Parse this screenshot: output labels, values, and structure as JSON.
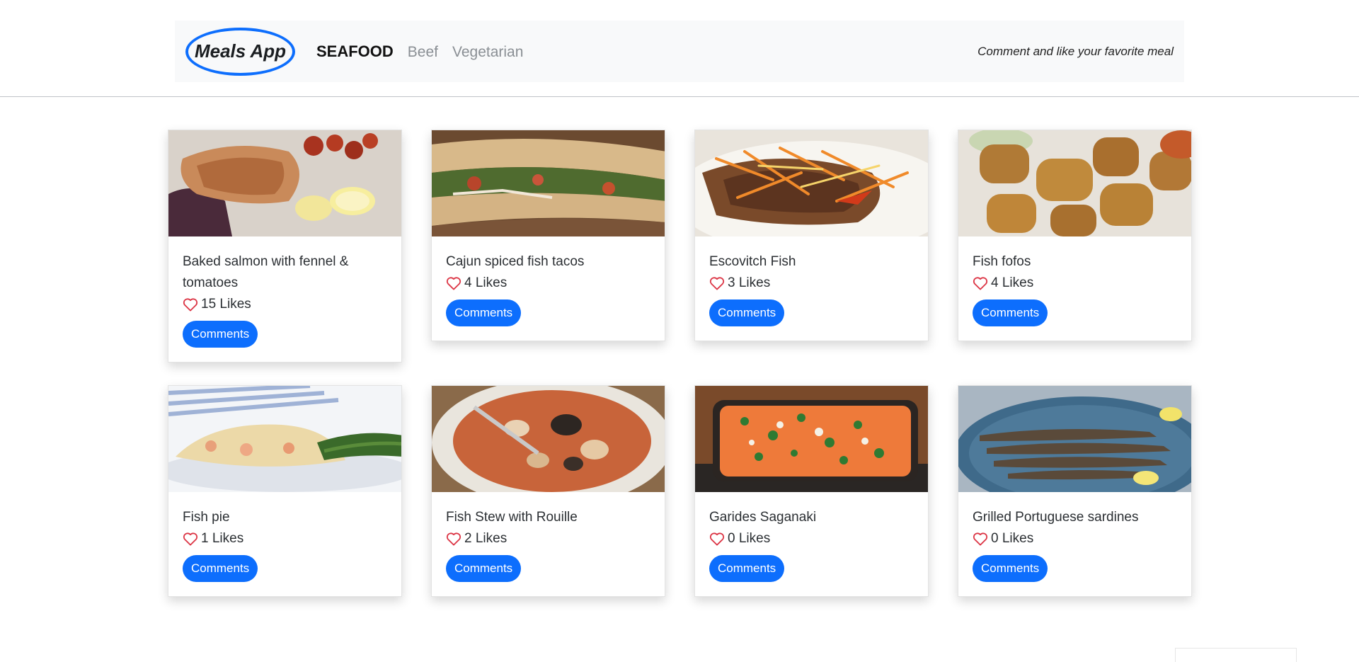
{
  "header": {
    "logo": "Meals App",
    "nav": [
      "SEAFOOD",
      "Beef",
      "Vegetarian"
    ],
    "tagline": "Comment and like your favorite meal"
  },
  "colors": {
    "accent": "#0d6efd",
    "heart": "#dc3545",
    "navbar_bg": "#f8f9fa"
  },
  "meals": [
    {
      "title": "Baked salmon with fennel & tomatoes",
      "likes": "15 Likes",
      "button": "Comments",
      "image": "baked-salmon-photo"
    },
    {
      "title": "Cajun spiced fish tacos",
      "likes": "4 Likes",
      "button": "Comments",
      "image": "fish-tacos-photo"
    },
    {
      "title": "Escovitch Fish",
      "likes": "3 Likes",
      "button": "Comments",
      "image": "escovitch-fish-photo"
    },
    {
      "title": "Fish fofos",
      "likes": "4 Likes",
      "button": "Comments",
      "image": "fish-fofos-photo"
    },
    {
      "title": "Fish pie",
      "likes": "1 Likes",
      "button": "Comments",
      "image": "fish-pie-photo"
    },
    {
      "title": "Fish Stew with Rouille",
      "likes": "2 Likes",
      "button": "Comments",
      "image": "fish-stew-photo"
    },
    {
      "title": "Garides Saganaki",
      "likes": "0 Likes",
      "button": "Comments",
      "image": "garides-saganaki-photo"
    },
    {
      "title": "Grilled Portuguese sardines",
      "likes": "0 Likes",
      "button": "Comments",
      "image": "grilled-sardines-photo"
    }
  ]
}
